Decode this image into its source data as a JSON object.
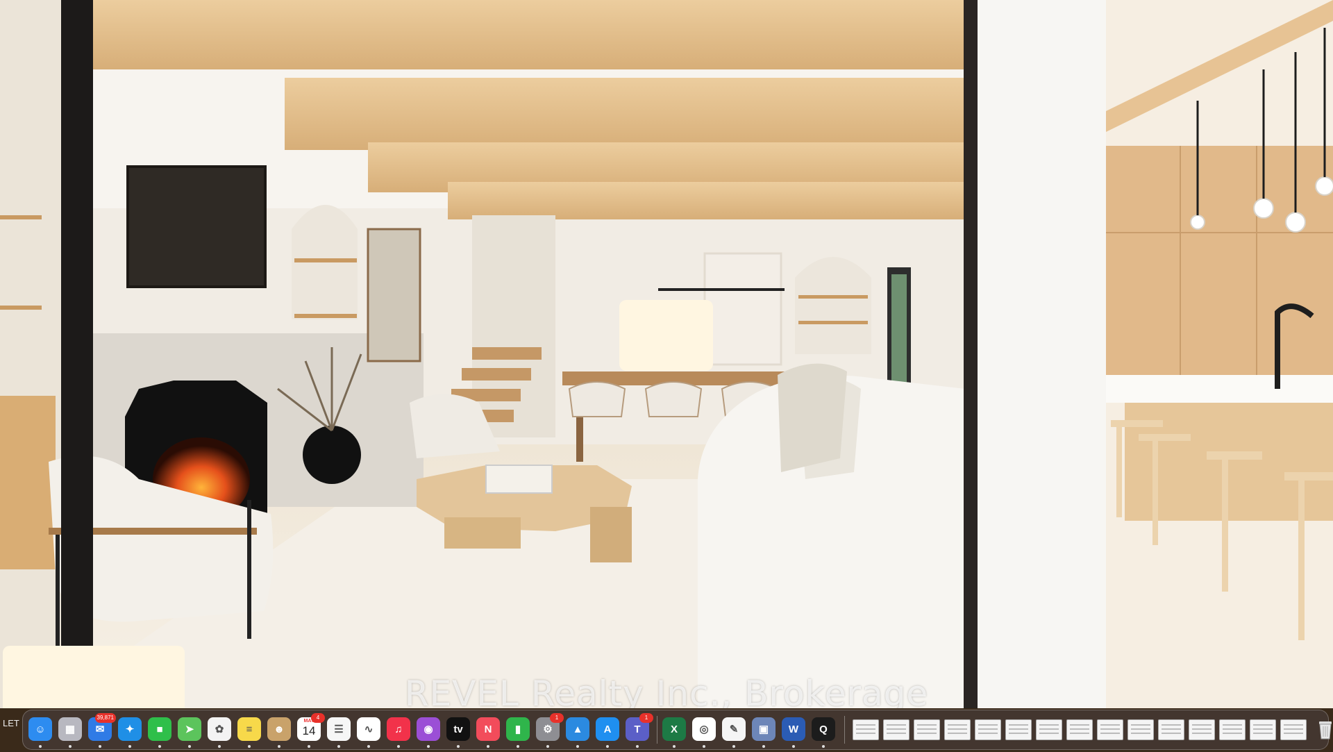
{
  "photo": {
    "watermark_text": "REVEL Realty Inc., Brokerage",
    "left_edge_text": "LET"
  },
  "dock": {
    "apps": [
      {
        "name": "finder-icon",
        "color": "#2d8cf0",
        "glyph": "☺"
      },
      {
        "name": "launchpad-icon",
        "color": "#b8b8c0",
        "glyph": "▦"
      },
      {
        "name": "mail-icon",
        "color": "#2f7be6",
        "glyph": "✉",
        "badge": "39,871"
      },
      {
        "name": "safari-icon",
        "color": "#1f8fe6",
        "glyph": "✦"
      },
      {
        "name": "facetime-icon",
        "color": "#2fbf4a",
        "glyph": "■"
      },
      {
        "name": "maps-icon",
        "color": "#5cc45c",
        "glyph": "➤"
      },
      {
        "name": "photos-icon",
        "color": "#f3f3f3",
        "glyph": "✿"
      },
      {
        "name": "notes-icon",
        "color": "#f7d94a",
        "glyph": "≡"
      },
      {
        "name": "contacts-icon",
        "color": "#c9a26a",
        "glyph": "☻"
      },
      {
        "name": "calendar-icon",
        "color": "#ffffff",
        "glyph": "",
        "month": "MAY",
        "day": "14",
        "badge": "4"
      },
      {
        "name": "reminders-icon",
        "color": "#f6f6f6",
        "glyph": "☰"
      },
      {
        "name": "freeform-icon",
        "color": "#ffffff",
        "glyph": "∿"
      },
      {
        "name": "music-icon",
        "color": "#f2324a",
        "glyph": "♫"
      },
      {
        "name": "podcasts-icon",
        "color": "#9b4fd6",
        "glyph": "◉"
      },
      {
        "name": "apple-tv-icon",
        "color": "#111111",
        "glyph": "tv"
      },
      {
        "name": "news-icon",
        "color": "#f24c5b",
        "glyph": "N"
      },
      {
        "name": "numbers-icon",
        "color": "#2fb54b",
        "glyph": "▮"
      },
      {
        "name": "system-settings-icon",
        "color": "#8e8e93",
        "glyph": "⚙",
        "badge": "1"
      },
      {
        "name": "keynote-icon",
        "color": "#2b8ae0",
        "glyph": "▲"
      },
      {
        "name": "app-store-icon",
        "color": "#1f8ff0",
        "glyph": "A"
      },
      {
        "name": "teams-icon",
        "color": "#5b5fc7",
        "glyph": "T",
        "badge": "1"
      },
      {
        "name": "excel-icon",
        "color": "#1d7a45",
        "glyph": "X"
      },
      {
        "name": "chrome-icon",
        "color": "#ffffff",
        "glyph": "◎"
      },
      {
        "name": "textedit-icon",
        "color": "#f5f5f5",
        "glyph": "✎"
      },
      {
        "name": "preview-icon",
        "color": "#6d86b8",
        "glyph": "▣"
      },
      {
        "name": "word-icon",
        "color": "#2b5cb4",
        "glyph": "W"
      },
      {
        "name": "quicktime-icon",
        "color": "#1c1c1c",
        "glyph": "Q"
      }
    ],
    "thumbnail_count": 15,
    "trash_icon": "trash-icon"
  }
}
